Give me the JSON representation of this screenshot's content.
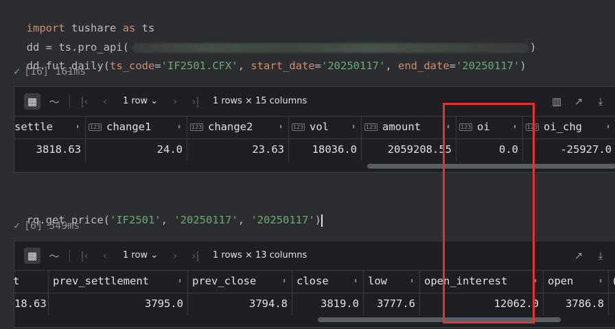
{
  "cell1": {
    "line1": {
      "kw1": "import",
      "mod": " tushare ",
      "kw2": "as",
      "alias": " ts"
    },
    "line2": {
      "text": "dd = ts.pro_api(",
      "close": ")"
    },
    "line3": {
      "prefix": "dd.fut_daily(",
      "p1": "ts_code",
      "v1": "'IF2501.CFX'",
      "p2": "start_date",
      "v2": "'20250117'",
      "p3": "end_date",
      "v3": "'20250117'",
      "suffix": ")"
    },
    "status": {
      "counter": "[16]",
      "time": "161ms"
    },
    "toolbar": {
      "rows_label": "1 row",
      "summary": "1 rows × 15 columns"
    },
    "columns": [
      {
        "type": "",
        "name": "settle"
      },
      {
        "type": "123",
        "name": "change1"
      },
      {
        "type": "123",
        "name": "change2"
      },
      {
        "type": "123",
        "name": "vol"
      },
      {
        "type": "123",
        "name": "amount"
      },
      {
        "type": "123",
        "name": "oi"
      },
      {
        "type": "123",
        "name": "oi_chg"
      }
    ],
    "values": [
      "3818.63",
      "24.0",
      "23.63",
      "18036.0",
      "2059208.55",
      "0.0",
      "-25927.0"
    ],
    "scroll_fraction": 0.48
  },
  "cell2": {
    "line1": {
      "prefix": "rq.get_price(",
      "a1": "'IF2501'",
      "a2": "'20250117'",
      "a3": "'20250117'",
      "suffix": ")"
    },
    "status": {
      "counter": "[6]",
      "time": "349ms"
    },
    "toolbar": {
      "rows_label": "1 row",
      "summary": "1 rows × 13 columns"
    },
    "columns": [
      {
        "type": "",
        "name": "t"
      },
      {
        "type": "",
        "name": "prev_settlement"
      },
      {
        "type": "",
        "name": "prev_close"
      },
      {
        "type": "",
        "name": "close"
      },
      {
        "type": "",
        "name": "low"
      },
      {
        "type": "",
        "name": "open_interest"
      },
      {
        "type": "",
        "name": "open"
      },
      {
        "type": "",
        "name": "("
      }
    ],
    "values": [
      "18.63",
      "3795.0",
      "3794.8",
      "3819.0",
      "3777.6",
      "12062.0",
      "3786.8",
      ""
    ],
    "scroll_fraction": 0.62
  },
  "colors": {
    "highlight": "#e8322c",
    "check": "#5fb865"
  }
}
